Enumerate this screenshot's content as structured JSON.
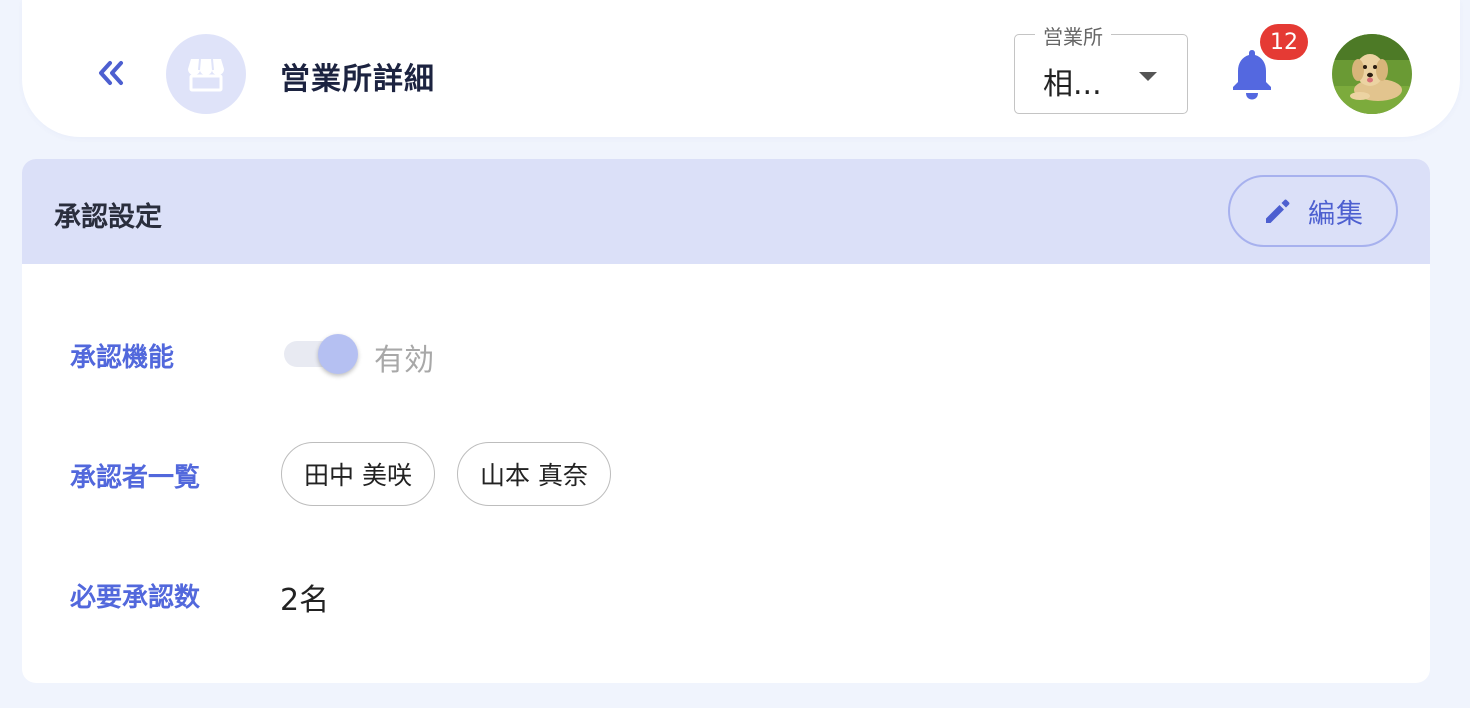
{
  "header": {
    "title": "営業所詳細",
    "office_select": {
      "label": "営業所",
      "value": "相..."
    },
    "notification_count": "12"
  },
  "card": {
    "title": "承認設定",
    "edit_label": "編集",
    "rows": {
      "approval_function": {
        "label": "承認機能",
        "status": "有効"
      },
      "approvers": {
        "label": "承認者一覧",
        "items": [
          "田中 美咲",
          "山本 真奈"
        ]
      },
      "required_count": {
        "label": "必要承認数",
        "value": "2名"
      }
    }
  },
  "icons": {
    "back": "double-chevron-left-icon",
    "store": "storefront-icon",
    "bell": "bell-icon",
    "edit": "pencil-icon"
  },
  "colors": {
    "accent": "#5268dc",
    "badge": "#e53a34",
    "card_header_bg": "#dbe0f8",
    "page_bg": "#f0f4fd"
  }
}
